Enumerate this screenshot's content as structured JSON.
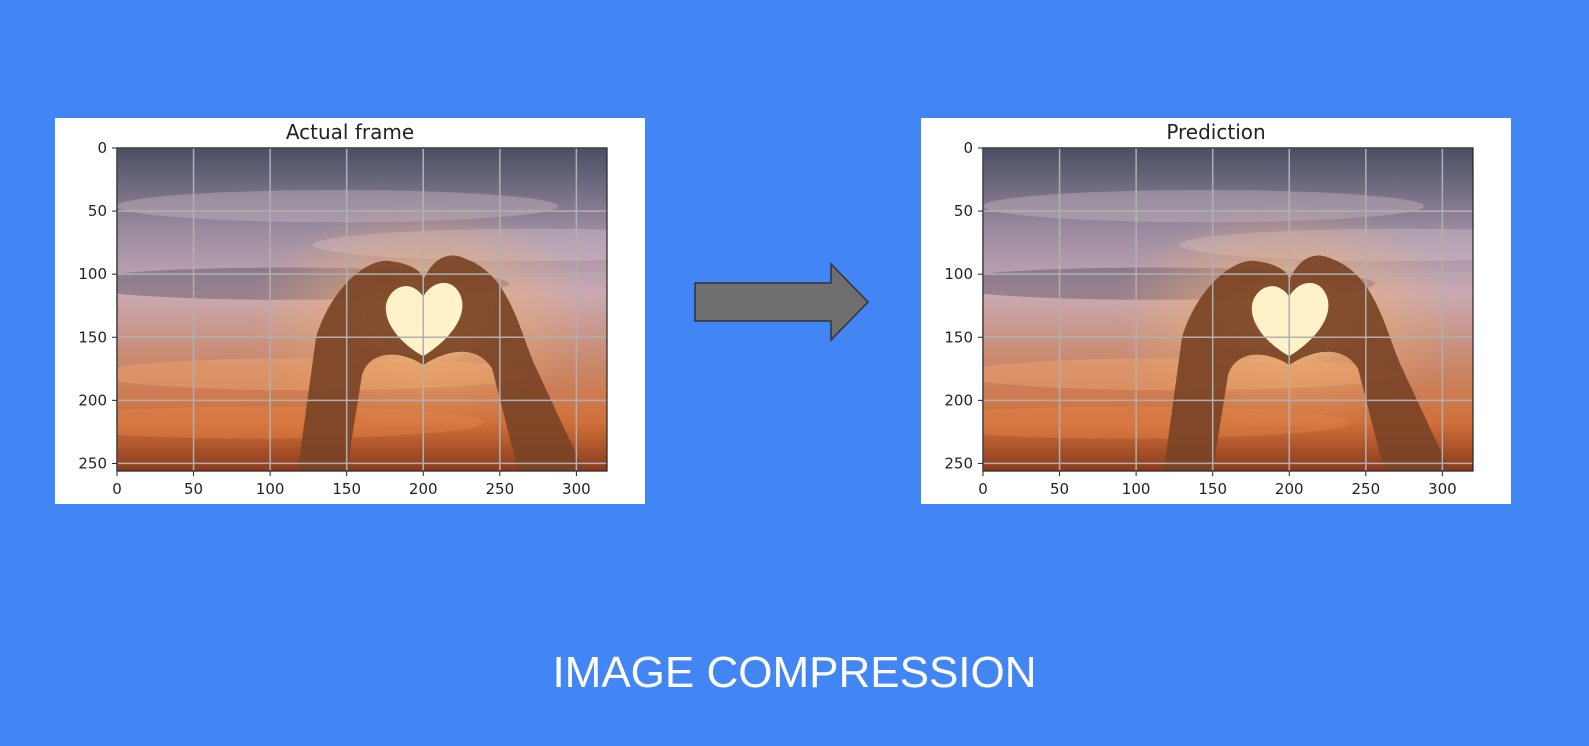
{
  "panels": [
    {
      "title": "Actual frame",
      "y_ticks": [
        "0",
        "50",
        "100",
        "150",
        "200",
        "250"
      ],
      "x_ticks": [
        "0",
        "50",
        "100",
        "150",
        "200",
        "250",
        "300"
      ],
      "image": "sunset sky with hands forming a heart shape"
    },
    {
      "title": "Prediction",
      "y_ticks": [
        "0",
        "50",
        "100",
        "150",
        "200",
        "250"
      ],
      "x_ticks": [
        "0",
        "50",
        "100",
        "150",
        "200",
        "250",
        "300"
      ],
      "image": "sunset sky with hands forming a heart shape"
    }
  ],
  "arrow": {
    "icon": "right-arrow-icon",
    "color": "#6e6e6e"
  },
  "caption": "IMAGE COMPRESSION",
  "colors": {
    "background": "#4285f4",
    "caption": "#ffffff"
  }
}
